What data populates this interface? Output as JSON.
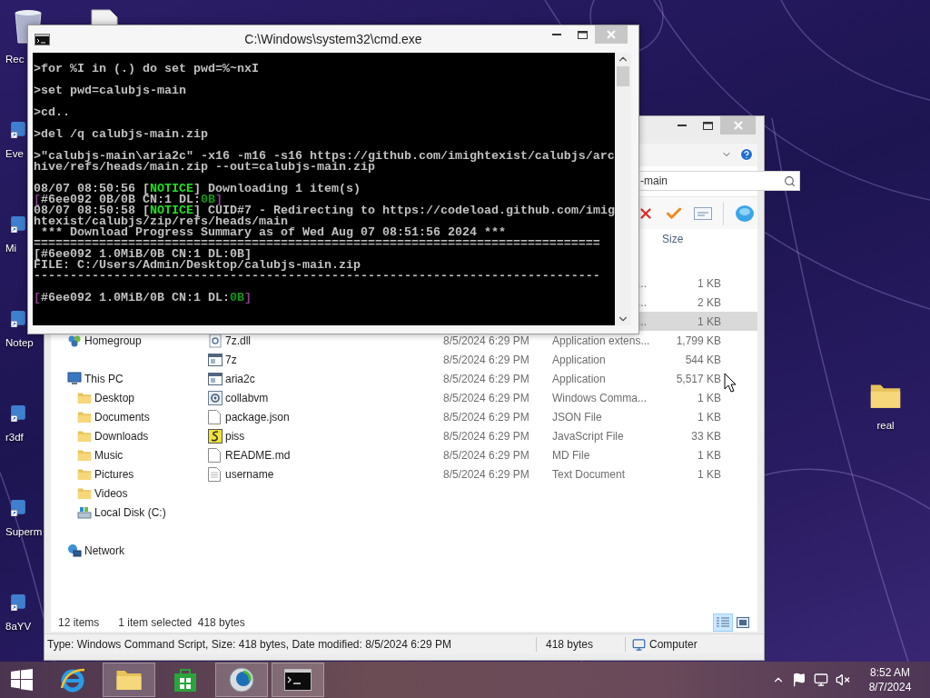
{
  "desktop_icons": [
    {
      "label": "Rec",
      "kind": "recycle-bin"
    },
    {
      "label": "Eve",
      "kind": "shortcut"
    },
    {
      "label": "Mi",
      "kind": "shortcut"
    },
    {
      "label": "Notep",
      "kind": "shortcut"
    },
    {
      "label": "r3df",
      "kind": "shortcut"
    },
    {
      "label": "Superm",
      "kind": "shortcut"
    },
    {
      "label": "8aYV",
      "kind": "shortcut"
    }
  ],
  "desktop_folder": {
    "label": "real"
  },
  "cmd": {
    "title": "C:\\Windows\\system32\\cmd.exe",
    "blocks": [
      {
        "lines": [
          {
            "segments": [
              {
                "kind": "plain",
                "text": ">for %I in (.) do set pwd=%~nxI"
              }
            ]
          }
        ]
      },
      {
        "lines": [
          {
            "segments": [
              {
                "kind": "plain",
                "text": ">set pwd=calubjs-main"
              }
            ]
          }
        ]
      },
      {
        "lines": [
          {
            "segments": [
              {
                "kind": "plain",
                "text": ">cd.."
              }
            ]
          }
        ]
      },
      {
        "lines": [
          {
            "segments": [
              {
                "kind": "plain",
                "text": ">del /q calubjs-main.zip"
              }
            ]
          }
        ]
      },
      {
        "lines": [
          {
            "segments": [
              {
                "kind": "plain",
                "text": ">\"calubjs-main\\aria2c\" -x16 -m16 -s16 https://github.com/imightexist/calubjs/arc"
              }
            ]
          },
          {
            "segments": [
              {
                "kind": "plain",
                "text": "hive/refs/heads/main.zip --out=calubjs-main.zip"
              }
            ]
          }
        ]
      },
      {
        "lines": [
          {
            "segments": [
              {
                "kind": "plain",
                "text": "08/07 08:50:56 ["
              },
              {
                "kind": "notice",
                "text": "NOTICE"
              },
              {
                "kind": "plain",
                "text": "] Downloading 1 item(s)"
              }
            ]
          },
          {
            "segments": [
              {
                "kind": "bracket",
                "text": "["
              },
              {
                "kind": "plain",
                "text": "#6ee092 0B/0B CN:1 DL:"
              },
              {
                "kind": "ok",
                "text": "0B"
              },
              {
                "kind": "bracket",
                "text": "]"
              }
            ]
          },
          {
            "segments": [
              {
                "kind": "plain",
                "text": "08/07 08:50:58 ["
              },
              {
                "kind": "notice",
                "text": "NOTICE"
              },
              {
                "kind": "plain",
                "text": "] CUID#7 - Redirecting to https://codeload.github.com/imig"
              }
            ]
          },
          {
            "segments": [
              {
                "kind": "plain",
                "text": "htexist/calubjs/zip/refs/heads/main"
              }
            ]
          },
          {
            "segments": [
              {
                "kind": "plain",
                "text": " *** Download Progress Summary as of Wed Aug 07 08:51:56 2024 ***"
              }
            ]
          },
          {
            "segments": [
              {
                "kind": "plain",
                "text": "=============================================================================="
              }
            ]
          },
          {
            "segments": [
              {
                "kind": "plain",
                "text": "[#6ee092 1.0MiB/0B CN:1 DL:0B]"
              }
            ]
          },
          {
            "segments": [
              {
                "kind": "plain",
                "text": "FILE: C:/Users/Admin/Desktop/calubjs-main.zip"
              }
            ]
          },
          {
            "segments": [
              {
                "kind": "plain",
                "text": "------------------------------------------------------------------------------"
              }
            ]
          }
        ]
      },
      {
        "lines": [
          {
            "segments": [
              {
                "kind": "bracket",
                "text": "["
              },
              {
                "kind": "plain",
                "text": "#6ee092 1.0MiB/0B CN:1 DL:"
              },
              {
                "kind": "ok",
                "text": "0B"
              },
              {
                "kind": "bracket",
                "text": "]"
              }
            ]
          }
        ]
      }
    ]
  },
  "explorer": {
    "search": {
      "value": "-main"
    },
    "size_header": "Size",
    "partial_rows": [
      {
        "type": "...",
        "size": "1 KB",
        "selected": false
      },
      {
        "type": "...",
        "size": "2 KB",
        "selected": false
      },
      {
        "type": "...",
        "size": "1 KB",
        "selected": true
      }
    ],
    "nav": [
      {
        "label": "Homegroup",
        "kind": "homegroup"
      },
      {
        "label": "This PC",
        "kind": "pc",
        "children": [
          {
            "label": "Desktop",
            "kind": "folder"
          },
          {
            "label": "Documents",
            "kind": "folder"
          },
          {
            "label": "Downloads",
            "kind": "folder"
          },
          {
            "label": "Music",
            "kind": "folder"
          },
          {
            "label": "Pictures",
            "kind": "folder"
          },
          {
            "label": "Videos",
            "kind": "folder"
          },
          {
            "label": "Local Disk (C:)",
            "kind": "drive"
          }
        ]
      },
      {
        "label": "Network",
        "kind": "network"
      }
    ],
    "rows": [
      {
        "kind": "dll",
        "name": "7z.dll",
        "date": "8/5/2024 6:29 PM",
        "type": "Application extens...",
        "size": "1,799 KB"
      },
      {
        "kind": "app",
        "name": "7z",
        "date": "8/5/2024 6:29 PM",
        "type": "Application",
        "size": "544 KB"
      },
      {
        "kind": "app",
        "name": "aria2c",
        "date": "8/5/2024 6:29 PM",
        "type": "Application",
        "size": "5,517 KB"
      },
      {
        "kind": "script",
        "name": "collabvm",
        "date": "8/5/2024 6:29 PM",
        "type": "Windows Comma...",
        "size": "1 KB"
      },
      {
        "kind": "file",
        "name": "package.json",
        "date": "8/5/2024 6:29 PM",
        "type": "JSON File",
        "size": "1 KB"
      },
      {
        "kind": "js",
        "name": "piss",
        "date": "8/5/2024 6:29 PM",
        "type": "JavaScript File",
        "size": "33 KB"
      },
      {
        "kind": "file",
        "name": "README.md",
        "date": "8/5/2024 6:29 PM",
        "type": "MD File",
        "size": "1 KB"
      },
      {
        "kind": "text",
        "name": "username",
        "date": "8/5/2024 6:29 PM",
        "type": "Text Document",
        "size": "1 KB"
      }
    ],
    "item_count": "12 items",
    "selection": "1 item selected  418 bytes",
    "views": [
      {
        "kind": "details",
        "selected": true
      },
      {
        "kind": "tiles",
        "selected": false
      }
    ],
    "status": {
      "description": "Type: Windows Command Script, Size: 418 bytes, Date modified: 8/5/2024 6:29 PM",
      "size": "418 bytes",
      "location": "Computer"
    }
  },
  "taskbar": {
    "apps": [
      {
        "kind": "ie",
        "open": false
      },
      {
        "kind": "explorer",
        "open": true
      },
      {
        "kind": "store",
        "open": false
      },
      {
        "kind": "globe",
        "open": true
      },
      {
        "kind": "console",
        "open": true
      }
    ],
    "clock": {
      "time": "8:52 AM",
      "date": "8/7/2024"
    }
  }
}
